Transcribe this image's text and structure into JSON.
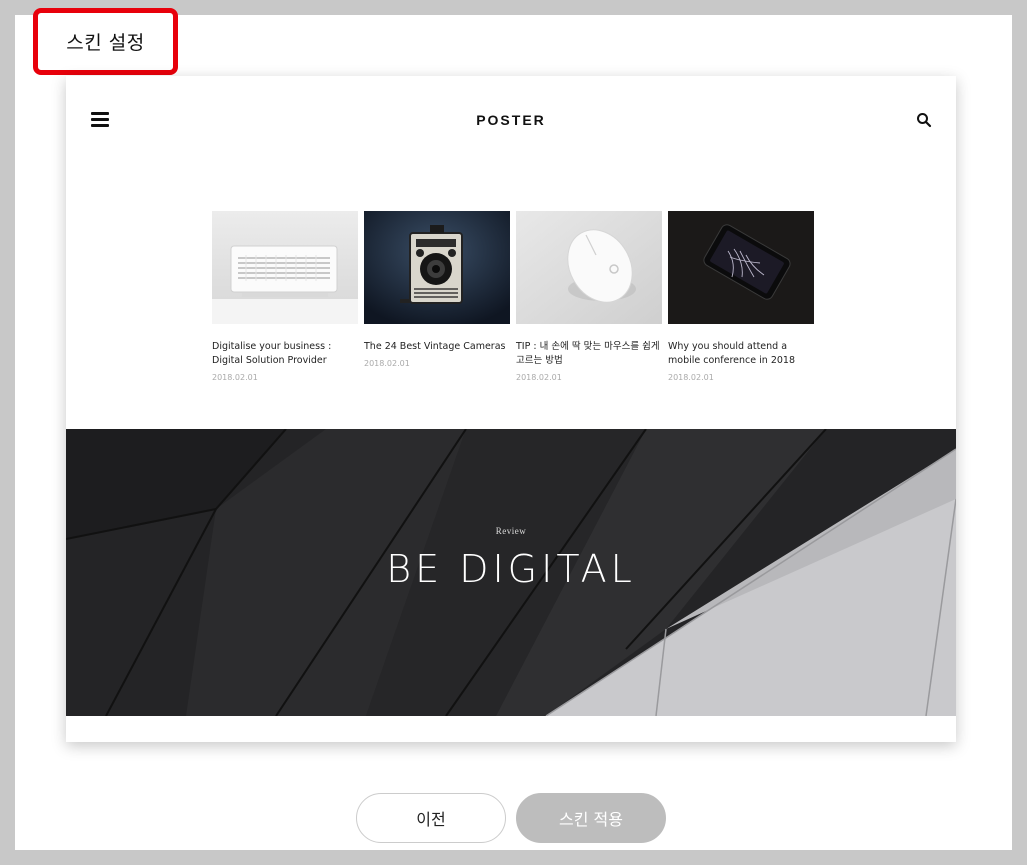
{
  "page": {
    "title": "스킨 설정"
  },
  "preview": {
    "logo": "POSTER",
    "menu_icon": "hamburger-menu-icon",
    "search_icon": "search-icon",
    "cards": [
      {
        "title": "Digitalise your business : Digital Solution Provider",
        "date": "2018.02.01",
        "image": "speaker-photo"
      },
      {
        "title": "The 24 Best Vintage Cameras",
        "date": "2018.02.01",
        "image": "vintage-camera-photo"
      },
      {
        "title": "TIP : 내 손에 딱 맞는 마우스를 쉽게 고르는 방법",
        "date": "2018.02.01",
        "image": "mouse-photo"
      },
      {
        "title": "Why you should attend a mobile conference in 2018",
        "date": "2018.02.01",
        "image": "phone-photo"
      }
    ],
    "hero": {
      "kicker": "Review",
      "title": "BE DIGITAL"
    }
  },
  "buttons": {
    "prev_label": "이전",
    "apply_label": "스킨 적용"
  },
  "colors": {
    "highlight_border": "#e8000b",
    "apply_button_bg": "#bdbdbd"
  }
}
